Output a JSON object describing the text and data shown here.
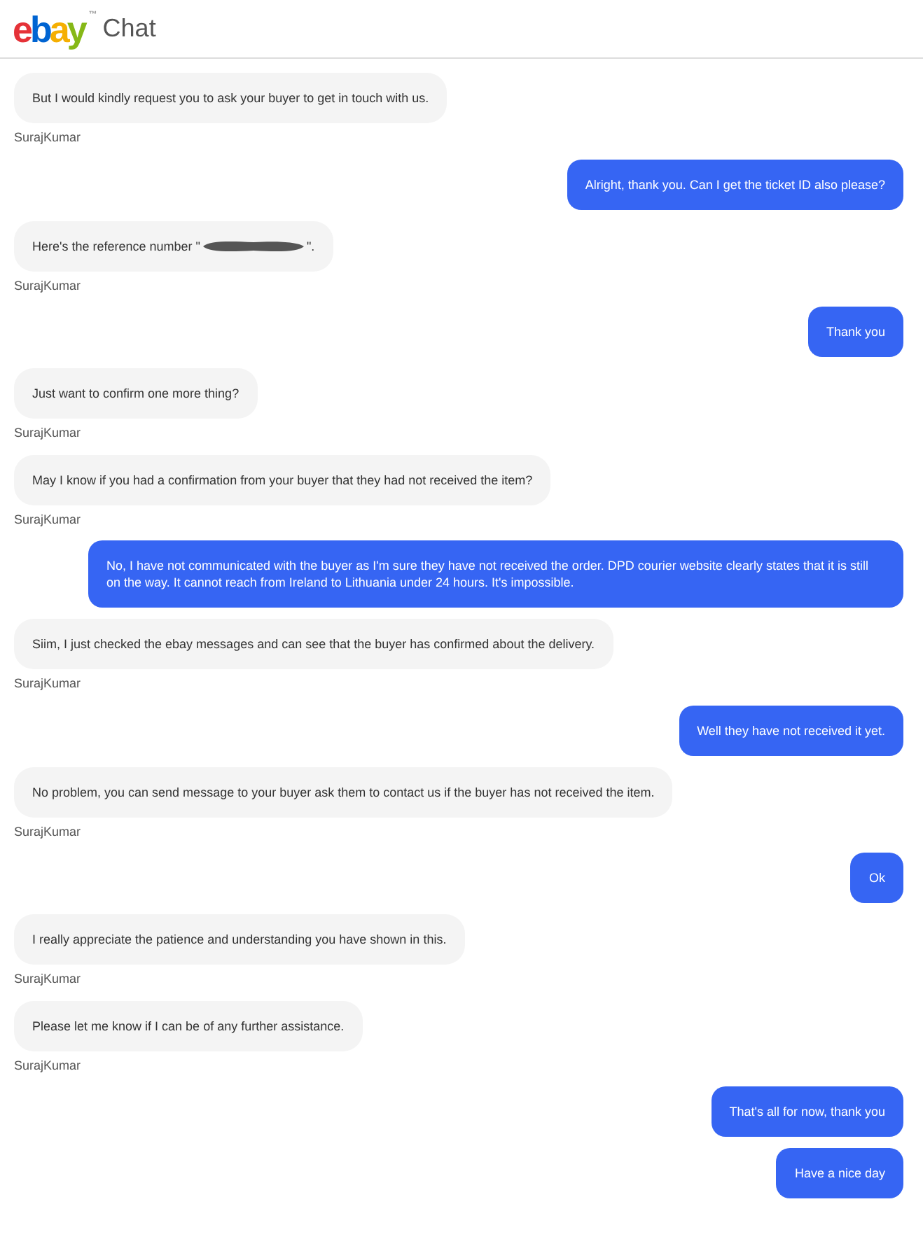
{
  "header": {
    "logo": [
      {
        "letter": "e",
        "color": "#e53238"
      },
      {
        "letter": "b",
        "color": "#0064d2"
      },
      {
        "letter": "a",
        "color": "#f5af02"
      },
      {
        "letter": "y",
        "color": "#86b817"
      }
    ],
    "trademark": "™",
    "title": "Chat"
  },
  "messages": [
    {
      "kind": "agent",
      "text": "But I would kindly request you to ask your buyer to get in touch with us.",
      "sender": "SurajKumar"
    },
    {
      "kind": "user",
      "text": "Alright, thank you. Can I get the ticket ID also please?"
    },
    {
      "kind": "agent",
      "text": "Here's the reference number \"",
      "redacted": true,
      "text_after": "\".",
      "sender": "SurajKumar"
    },
    {
      "kind": "user",
      "text": "Thank you"
    },
    {
      "kind": "agent",
      "text": "Just want to confirm one more thing?",
      "sender": "SurajKumar"
    },
    {
      "kind": "agent",
      "text": "May I know if you had a confirmation from your buyer that they had not received the item?",
      "sender": "SurajKumar"
    },
    {
      "kind": "user",
      "text": "No, I have not communicated with the buyer as I'm sure they have not received the order. DPD courier website clearly states that it is still on the way. It cannot reach from Ireland to Lithuania under 24 hours. It's impossible."
    },
    {
      "kind": "agent",
      "text": "Siim, I just checked the ebay messages and can see that the buyer has confirmed about the delivery.",
      "sender": "SurajKumar"
    },
    {
      "kind": "user",
      "text": "Well they have not received it yet."
    },
    {
      "kind": "agent",
      "text": "No problem, you can send message to your buyer ask them to contact us if the buyer has not received the item.",
      "sender": "SurajKumar"
    },
    {
      "kind": "user",
      "text": "Ok"
    },
    {
      "kind": "agent",
      "text": "I really appreciate the patience and understanding you have shown in this.",
      "sender": "SurajKumar"
    },
    {
      "kind": "agent",
      "text": "Please let me know if I can be of any further assistance.",
      "sender": "SurajKumar"
    },
    {
      "kind": "user",
      "text": "That's all for now, thank you"
    },
    {
      "kind": "user",
      "text": "Have a nice day"
    }
  ]
}
